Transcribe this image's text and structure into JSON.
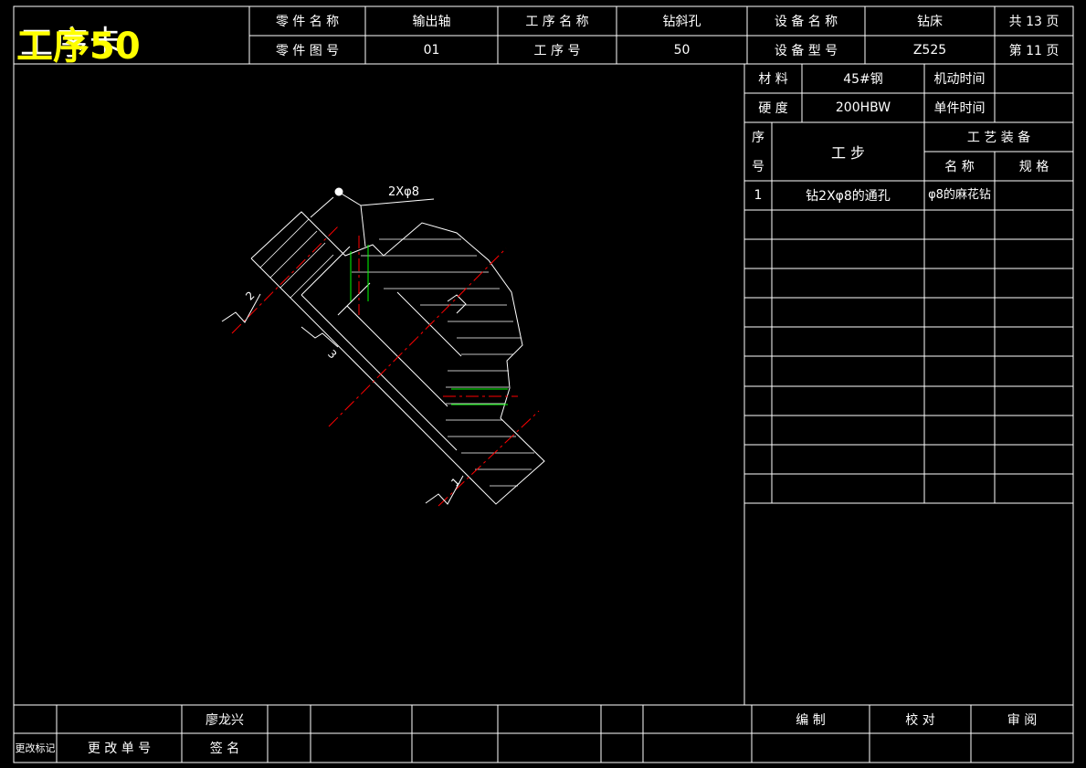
{
  "title": {
    "card_label": "工序卡",
    "overlay": "工序50"
  },
  "header": {
    "part_name_label": "零 件 名 称",
    "part_name": "输出轴",
    "process_name_label": "工 序 名 称",
    "process_name": "钻斜孔",
    "equip_name_label": "设 备 名 称",
    "equip_name": "钻床",
    "total_pages": "共 13 页",
    "part_drawing_label": "零 件 图 号",
    "part_drawing": "01",
    "process_no_label": "工   序   号",
    "process_no": "50",
    "equip_model_label": "设 备 型 号",
    "equip_model": "Z525",
    "page_no": "第 11 页"
  },
  "props": {
    "material_label": "材 料",
    "material": "45#钢",
    "machine_time_label": "机动时间",
    "machine_time": "",
    "hardness_label": "硬 度",
    "hardness": "200HBW",
    "unit_time_label": "单件时间",
    "unit_time": ""
  },
  "steps_table": {
    "no_label_top": "序",
    "no_label_bottom": "号",
    "step_label": "工     步",
    "equipment_label": "工 艺 装 备",
    "name_label": "名 称",
    "spec_label": "规 格",
    "rows": [
      {
        "no": "1",
        "step": "钻2Xφ8的通孔",
        "name": "φ8的麻花钻",
        "spec": ""
      }
    ]
  },
  "drawing": {
    "hole_callout": "2Xφ8",
    "surface_labels": [
      "2",
      "3",
      "1"
    ]
  },
  "footer": {
    "change_mark": "更改标记",
    "change_no": "更 改 单 号",
    "designer": "廖龙兴",
    "sign": "签 名",
    "compile": "编     制",
    "check": "校     对",
    "review": "审     阅"
  }
}
